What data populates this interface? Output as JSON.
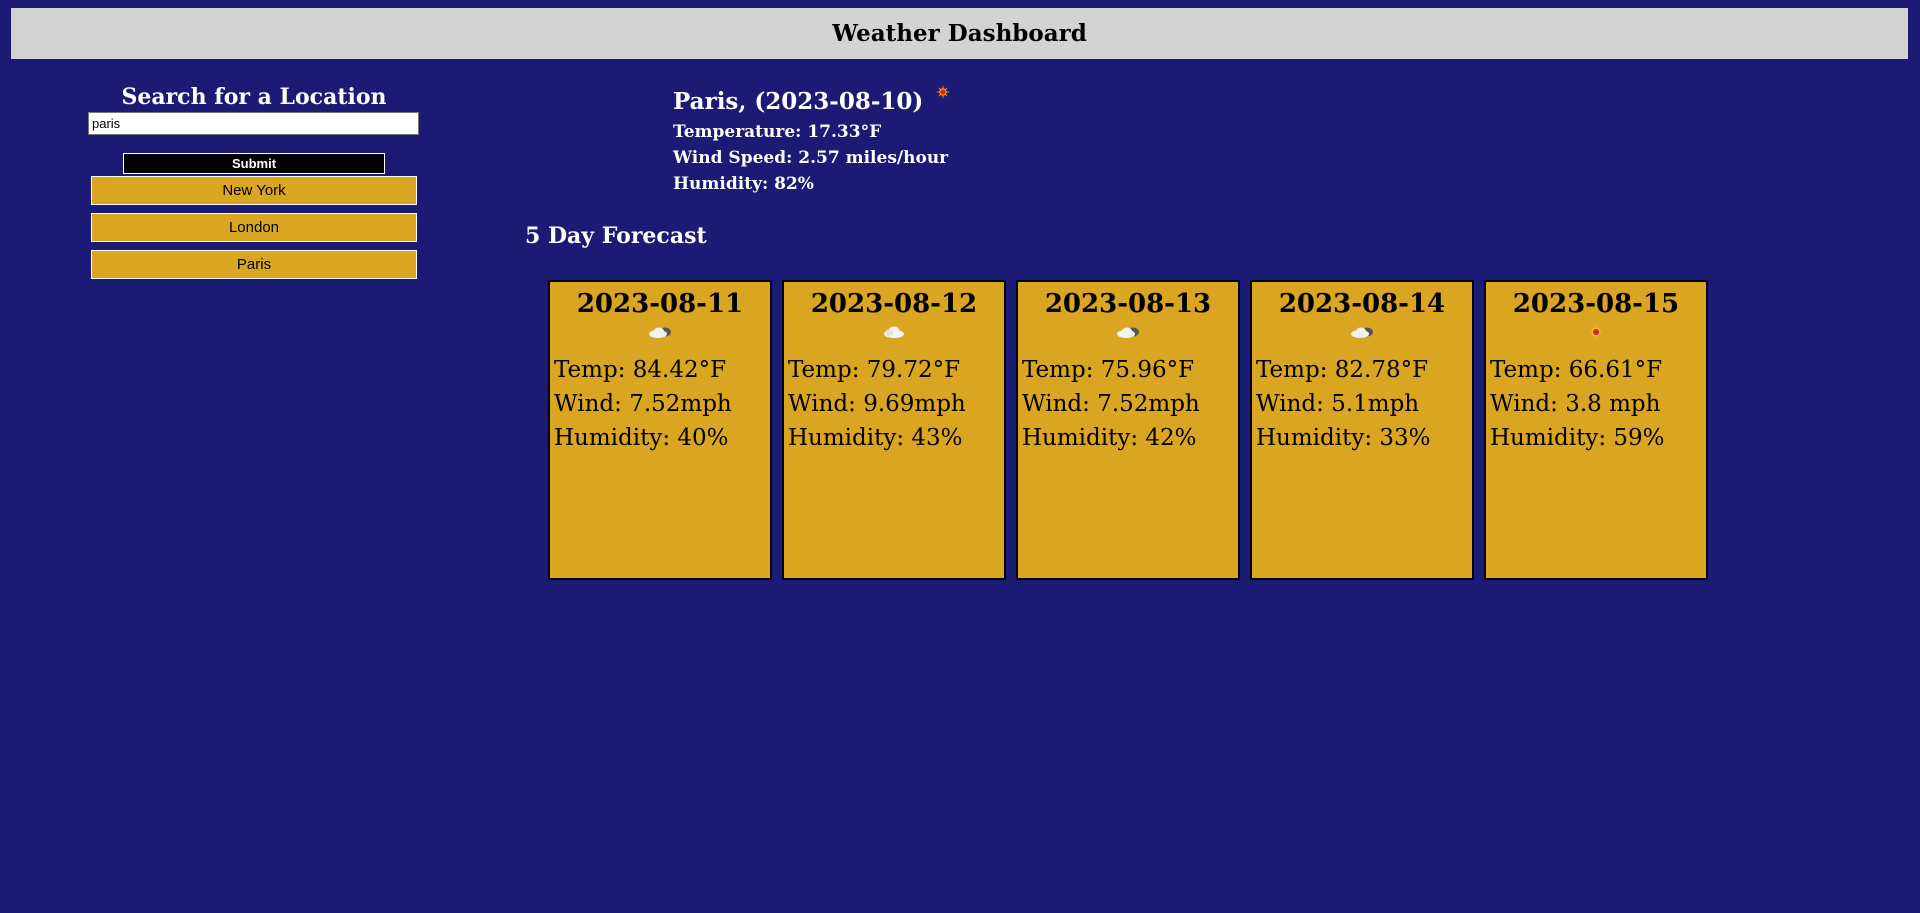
{
  "header": {
    "title": "Weather Dashboard"
  },
  "sidebar": {
    "title": "Search for a Location",
    "search_value": "paris",
    "submit_label": "Submit",
    "history": [
      "New York",
      "London",
      "Paris"
    ]
  },
  "current": {
    "title": "Paris, (2023-08-10)",
    "icon": "sun-icon",
    "temperature": "Temperature: 17.33°F",
    "wind": "Wind Speed: 2.57 miles/hour",
    "humidity": "Humidity: 82%"
  },
  "forecast": {
    "title": "5 Day Forecast",
    "days": [
      {
        "date": "2023-08-11",
        "icon": "cloudy-night-icon",
        "temp": "Temp: 84.42°F",
        "wind": "Wind: 7.52mph",
        "humidity": "Humidity: 40%"
      },
      {
        "date": "2023-08-12",
        "icon": "cloud-icon",
        "temp": "Temp: 79.72°F",
        "wind": "Wind: 9.69mph",
        "humidity": "Humidity: 43%"
      },
      {
        "date": "2023-08-13",
        "icon": "cloudy-night-icon",
        "temp": "Temp: 75.96°F",
        "wind": "Wind: 7.52mph",
        "humidity": "Humidity: 42%"
      },
      {
        "date": "2023-08-14",
        "icon": "cloudy-night-icon",
        "temp": "Temp: 82.78°F",
        "wind": "Wind: 5.1mph",
        "humidity": "Humidity: 33%"
      },
      {
        "date": "2023-08-15",
        "icon": "sun-icon",
        "temp": "Temp: 66.61°F",
        "wind": "Wind: 3.8 mph",
        "humidity": "Humidity: 59%"
      }
    ]
  },
  "colors": {
    "background": "#1b1b75",
    "header": "#d3d3d3",
    "card": "#daa520",
    "submit": "#000000"
  }
}
